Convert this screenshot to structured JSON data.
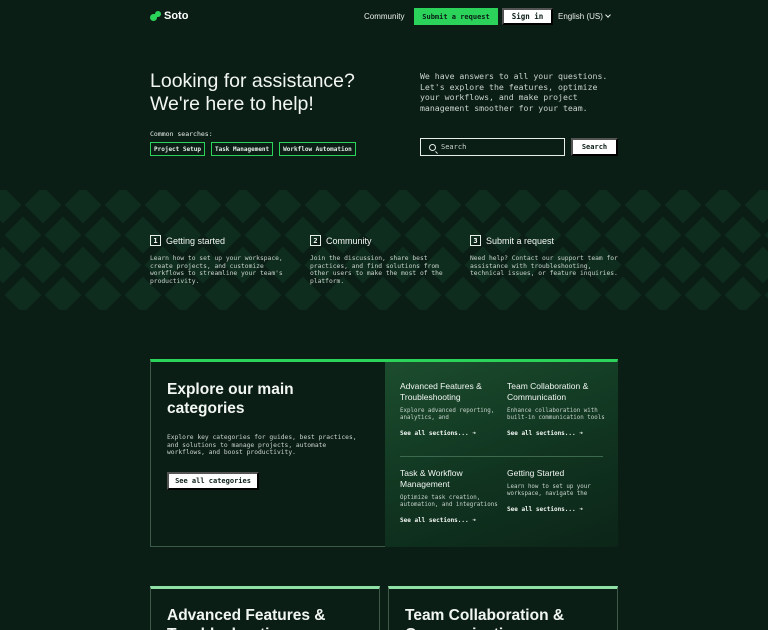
{
  "header": {
    "logo": "Soto",
    "community": "Community",
    "submit_request": "Submit a request",
    "sign_in": "Sign in",
    "language": "English (US)"
  },
  "hero": {
    "title_line1": "Looking for assistance?",
    "title_line2": "We're here to help!",
    "common_label": "Common searches:",
    "chips": [
      "Project Setup",
      "Task Management",
      "Workflow Automation"
    ],
    "description": "We have answers to all your questions. Let's explore the features, optimize your workflows, and make project management smoother for your team.",
    "search_placeholder": "Search",
    "search_button": "Search"
  },
  "steps": [
    {
      "num": "1",
      "title": "Getting started",
      "desc": "Learn how to set up your workspace, create projects, and customize workflows to streamline your team's productivity."
    },
    {
      "num": "2",
      "title": "Community",
      "desc": "Join the discussion, share best practices, and find solutions from other users to make the most of the platform."
    },
    {
      "num": "3",
      "title": "Submit a request",
      "desc": "Need help? Contact our support team for assistance with troubleshooting, technical issues, or feature inquiries."
    }
  ],
  "explore": {
    "title": "Explore our main categories",
    "desc": "Explore key categories for guides, best practices, and solutions to manage projects, automate workflows, and boost productivity.",
    "button": "See all categories",
    "categories": [
      {
        "title": "Advanced Features & Troubleshooting",
        "desc": "Explore advanced reporting, analytics, and",
        "link": "See all sections... ➜"
      },
      {
        "title": "Team Collaboration & Communication",
        "desc": "Enhance collaboration with built-in communication tools",
        "link": "See all sections... ➜"
      },
      {
        "title": "Task & Workflow Management",
        "desc": "Optimize task creation, automation, and integrations",
        "link": "See all sections... ➜"
      },
      {
        "title": "Getting Started",
        "desc": "Learn how to set up your workspace, navigate the",
        "link": "See all sections... ➜"
      }
    ]
  },
  "bottom_cards": [
    {
      "title": "Advanced Features & Troubleshooting"
    },
    {
      "title": "Team Collaboration & Communication"
    }
  ],
  "colors": {
    "background": "#0b1e16",
    "accent": "#2bd35a",
    "pattern": "#0f2d1f"
  }
}
